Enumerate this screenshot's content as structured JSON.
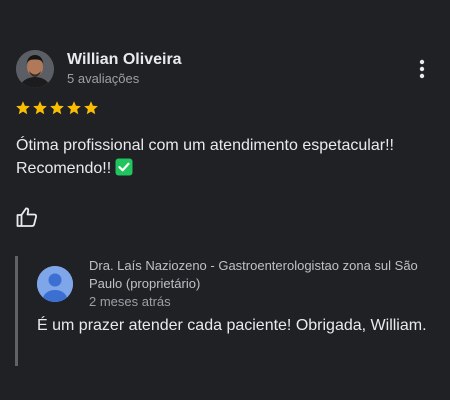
{
  "review": {
    "author_name": "Willian Oliveira",
    "author_meta": "5 avaliações",
    "rating": 5,
    "rating_max": 5,
    "text_line1": "Ótima profissional com um atendimento espetacular!!",
    "text_line2": "Recomendo!!",
    "emoji": "✅",
    "actions": {
      "more_icon": "more-vert-icon",
      "like_icon": "thumbs-up-icon"
    }
  },
  "owner_response": {
    "name": "Dra. Laís Naziozeno - Gastroenterologistao zona sul São Paulo (proprietário)",
    "date": "2 meses atrás",
    "text": "É um prazer atender cada paciente! Obrigada, William."
  },
  "colors": {
    "background": "#202124",
    "star": "#fbbc04",
    "owner_avatar": "#7fa6e9",
    "check_emoji": "#21c55d"
  }
}
